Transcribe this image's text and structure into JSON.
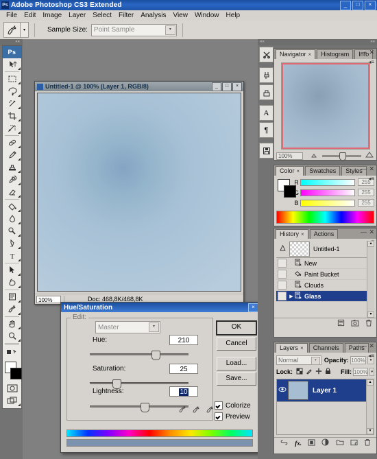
{
  "window": {
    "title": "Adobe Photoshop CS3 Extended",
    "app_mark": "Ps",
    "minimize": "_",
    "maximize": "□",
    "close": "×"
  },
  "menubar": {
    "items": [
      "File",
      "Edit",
      "Image",
      "Layer",
      "Select",
      "Filter",
      "Analysis",
      "View",
      "Window",
      "Help"
    ]
  },
  "options_bar": {
    "tool_icon": "eyedropper-icon",
    "preset_arrow": "▾",
    "sample_size_label": "Sample Size:",
    "sample_size_value": "Point Sample",
    "dropdown_glyph": "▾"
  },
  "toolbox": {
    "logo": "Ps",
    "grip": "««",
    "tools": [
      {
        "name": "move-tool",
        "icon": "arrow-move"
      },
      {
        "name": "marquee-tool",
        "icon": "dashed-rect"
      },
      {
        "name": "lasso-tool",
        "icon": "lasso"
      },
      {
        "name": "magic-wand-tool",
        "icon": "wand"
      },
      {
        "name": "crop-tool",
        "icon": "crop"
      },
      {
        "name": "slice-tool",
        "icon": "slice"
      },
      {
        "name": "healing-brush-tool",
        "icon": "bandage"
      },
      {
        "name": "brush-tool",
        "icon": "brush"
      },
      {
        "name": "clone-stamp-tool",
        "icon": "stamp"
      },
      {
        "name": "history-brush-tool",
        "icon": "history-brush"
      },
      {
        "name": "eraser-tool",
        "icon": "eraser"
      },
      {
        "name": "gradient-tool",
        "icon": "paint-bucket"
      },
      {
        "name": "blur-tool",
        "icon": "droplet"
      },
      {
        "name": "dodge-tool",
        "icon": "dodge"
      },
      {
        "name": "pen-tool",
        "icon": "pen"
      },
      {
        "name": "type-tool",
        "icon": "letter-T"
      },
      {
        "name": "path-selection-tool",
        "icon": "black-arrow"
      },
      {
        "name": "shape-tool",
        "icon": "custom-shape"
      },
      {
        "name": "notes-tool",
        "icon": "note"
      },
      {
        "name": "eyedropper-tool",
        "icon": "eyedropper"
      },
      {
        "name": "hand-tool",
        "icon": "hand"
      },
      {
        "name": "zoom-tool",
        "icon": "magnifier"
      }
    ],
    "foreground_color": "#ffffff",
    "background_color": "#000000",
    "quick_mask_icon": "quick-mask-icon",
    "screen_mode_icon": "screen-mode-icon"
  },
  "document": {
    "title": "Untitled-1 @ 100% (Layer 1, RGB/8)",
    "minimize": "_",
    "maximize": "□",
    "close": "×",
    "zoom": "100%",
    "doc_size": "Doc: 468,8K/468,8K",
    "canvas_base_color": "#7e97b2"
  },
  "dialog": {
    "title": "Hue/Saturation",
    "close": "×",
    "edit_label": "Edit:",
    "edit_value": "Master",
    "edit_arrow": "▾",
    "fields": [
      {
        "label": "Hue:",
        "value": "210",
        "slider_pct": 68,
        "selected": false
      },
      {
        "label": "Saturation:",
        "value": "25",
        "slider_pct": 25,
        "selected": false
      },
      {
        "label": "Lightness:",
        "value": "10",
        "slider_pct": 56,
        "selected": true
      }
    ],
    "buttons": [
      {
        "name": "ok-button",
        "label": "OK",
        "default": true
      },
      {
        "name": "cancel-button",
        "label": "Cancel",
        "default": false
      },
      {
        "name": "load-button",
        "label": "Load...",
        "default": false
      },
      {
        "name": "save-button",
        "label": "Save...",
        "default": false
      }
    ],
    "checkboxes": [
      {
        "name": "colorize-checkbox",
        "label": "Colorize",
        "checked": true
      },
      {
        "name": "preview-checkbox",
        "label": "Preview",
        "checked": true
      }
    ],
    "eyedroppers": [
      "eyedropper-icon",
      "eyedropper-plus-icon",
      "eyedropper-minus-icon"
    ],
    "result_color": "#7b93ae"
  },
  "dock": {
    "grip_left": "««",
    "grip_right": "»»",
    "icons": [
      {
        "name": "tool-presets-icon",
        "glyph": "✂"
      },
      {
        "name": "brushes-icon",
        "glyph": "brush"
      },
      {
        "name": "clone-source-icon",
        "glyph": "stamp"
      },
      {
        "name": "character-icon",
        "glyph": "A"
      },
      {
        "name": "paragraph-icon",
        "glyph": "¶"
      },
      {
        "name": "layer-comps-icon",
        "glyph": "save"
      }
    ]
  },
  "navigator_panel": {
    "tabs": [
      {
        "label": "Navigator",
        "active": true,
        "closable": true
      },
      {
        "label": "Histogram",
        "active": false,
        "closable": false
      },
      {
        "label": "Info",
        "active": false,
        "closable": false
      }
    ],
    "minimize": "—",
    "close": "✕",
    "menu": "◂≡",
    "zoom_value": "100%",
    "view_box_color": "#e06a74",
    "zoom_out_icon": "small-mountain-icon",
    "zoom_in_icon": "large-mountain-icon",
    "slider_pct": 50
  },
  "color_panel": {
    "tabs": [
      {
        "label": "Color",
        "active": true,
        "closable": true
      },
      {
        "label": "Swatches",
        "active": false,
        "closable": false
      },
      {
        "label": "Styles",
        "active": false,
        "closable": false
      }
    ],
    "minimize": "—",
    "close": "✕",
    "menu": "◂≡",
    "foreground_color": "#ffffff",
    "background_color": "#000000",
    "channels": [
      {
        "label": "R",
        "value": "255",
        "ramp_from": "#00ffff",
        "ramp_to": "#ffffff"
      },
      {
        "label": "G",
        "value": "255",
        "ramp_from": "#ff00ff",
        "ramp_to": "#ffffff"
      },
      {
        "label": "B",
        "value": "255",
        "ramp_from": "#ffff00",
        "ramp_to": "#ffffff"
      }
    ]
  },
  "history_panel": {
    "tabs": [
      {
        "label": "History",
        "active": true,
        "closable": true
      },
      {
        "label": "Actions",
        "active": false,
        "closable": false
      }
    ],
    "minimize": "—",
    "close": "✕",
    "menu": "◂≡",
    "snapshot": {
      "label": "Untitled-1",
      "icon": "snapshot-icon"
    },
    "states": [
      {
        "label": "New",
        "icon": "new-document-icon",
        "selected": false
      },
      {
        "label": "Paint Bucket",
        "icon": "paint-bucket-icon",
        "selected": false
      },
      {
        "label": "Clouds",
        "icon": "new-document-icon",
        "selected": false
      },
      {
        "label": "Glass",
        "icon": "new-document-icon",
        "selected": true
      }
    ],
    "footer_icons": [
      {
        "name": "create-document-from-state-icon",
        "glyph": "▤"
      },
      {
        "name": "create-snapshot-icon",
        "glyph": "◳"
      },
      {
        "name": "delete-state-icon",
        "glyph": "🗑"
      }
    ]
  },
  "layers_panel": {
    "tabs": [
      {
        "label": "Layers",
        "active": true,
        "closable": true
      },
      {
        "label": "Channels",
        "active": false,
        "closable": false
      },
      {
        "label": "Paths",
        "active": false,
        "closable": false
      }
    ],
    "minimize": "—",
    "close": "✕",
    "menu": "◂≡",
    "blend_mode": "Normal",
    "opacity_label": "Opacity:",
    "opacity_value": "100%",
    "lock_label": "Lock:",
    "lock_icons": [
      {
        "name": "lock-transparent-pixels-icon",
        "glyph": "▨"
      },
      {
        "name": "lock-image-pixels-icon",
        "glyph": "brush"
      },
      {
        "name": "lock-position-icon",
        "glyph": "✛"
      },
      {
        "name": "lock-all-icon",
        "glyph": "lock"
      }
    ],
    "fill_label": "Fill:",
    "fill_value": "100%",
    "layers": [
      {
        "name": "Layer 1",
        "visible": true,
        "selected": true
      }
    ],
    "footer_icons": [
      {
        "name": "link-layers-icon",
        "glyph": "∞"
      },
      {
        "name": "layer-style-icon",
        "glyph": "fx"
      },
      {
        "name": "add-layer-mask-icon",
        "glyph": "▣"
      },
      {
        "name": "new-adjustment-layer-icon",
        "glyph": "◑"
      },
      {
        "name": "new-group-icon",
        "glyph": "▭"
      },
      {
        "name": "new-layer-icon",
        "glyph": "▢"
      },
      {
        "name": "delete-layer-icon",
        "glyph": "🗑"
      }
    ]
  }
}
